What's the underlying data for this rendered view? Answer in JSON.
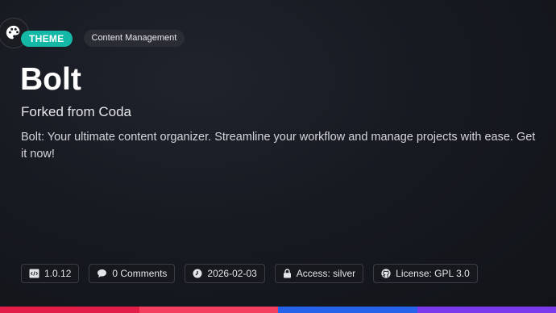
{
  "badges": {
    "theme_label": "THEME",
    "category_label": "Content Management"
  },
  "header": {
    "title": "Bolt",
    "subtitle": "Forked from Coda",
    "description": "Bolt: Your ultimate content organizer. Streamline your workflow and manage projects with ease. Get it now!"
  },
  "meta": {
    "version": "1.0.12",
    "comments": "0 Comments",
    "date": "2026-02-03",
    "access": "Access: silver",
    "license": "License: GPL 3.0"
  },
  "icons": {
    "badge": "palette-icon",
    "version": "code-file-icon",
    "comments": "speech-bubble-icon",
    "date": "clock-icon",
    "access": "lock-icon",
    "license": "github-icon"
  },
  "colors": {
    "background": "#121419",
    "theme_badge": "#14b8a6",
    "category_badge": "#2a2d34",
    "bottom_bar": [
      "#e11d48",
      "#f43f5e",
      "#2563eb",
      "#7c3aed"
    ]
  }
}
